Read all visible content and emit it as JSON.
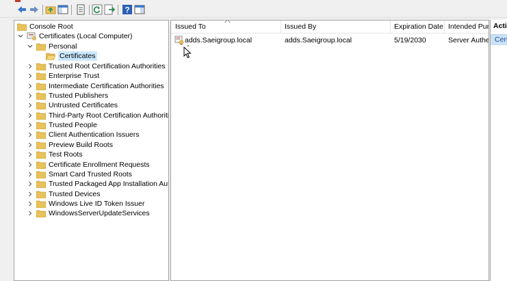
{
  "toolbar": {
    "buttons": [
      {
        "name": "back-button",
        "icon": "arrow-left-icon"
      },
      {
        "name": "forward-button",
        "icon": "arrow-right-icon"
      },
      {
        "name": "up-one-level-button",
        "icon": "folder-up-icon"
      },
      {
        "name": "show-hide-console-tree-button",
        "icon": "console-tree-icon"
      },
      {
        "name": "properties-button",
        "icon": "properties-icon"
      },
      {
        "name": "refresh-button",
        "icon": "refresh-icon"
      },
      {
        "name": "export-list-button",
        "icon": "export-list-icon"
      },
      {
        "name": "help-button",
        "icon": "help-icon"
      },
      {
        "name": "show-hide-action-pane-button",
        "icon": "action-pane-icon"
      }
    ],
    "colors": {
      "arrow": "#3a78c8",
      "accent": "#2e8b57"
    }
  },
  "tree": {
    "root": "Console Root",
    "computer": "Certificates (Local Computer)",
    "personal": "Personal",
    "certificates": "Certificates",
    "stores": [
      "Trusted Root Certification Authorities",
      "Enterprise Trust",
      "Intermediate Certification Authorities",
      "Trusted Publishers",
      "Untrusted Certificates",
      "Third-Party Root Certification Authorities",
      "Trusted People",
      "Client Authentication Issuers",
      "Preview Build Roots",
      "Test Roots",
      "Certificate Enrollment Requests",
      "Smart Card Trusted Roots",
      "Trusted Packaged App Installation Author",
      "Trusted Devices",
      "Windows Live ID Token Issuer",
      "WindowsServerUpdateServices"
    ],
    "colors": {
      "folder": "#e8c25b",
      "selection": "#cce8ff"
    }
  },
  "list": {
    "columns": [
      "Issued To",
      "Issued By",
      "Expiration Date",
      "Intended Purp"
    ],
    "rows": [
      {
        "issued_to": "adds.Saeigroup.local",
        "issued_by": "adds.Saeigroup.local",
        "expiration": "5/19/2030",
        "purpose": "Server Auther"
      }
    ]
  },
  "actions": {
    "title": "Actio",
    "item": "Cert",
    "colors": {
      "item_bg": "#cbe1f5"
    }
  }
}
